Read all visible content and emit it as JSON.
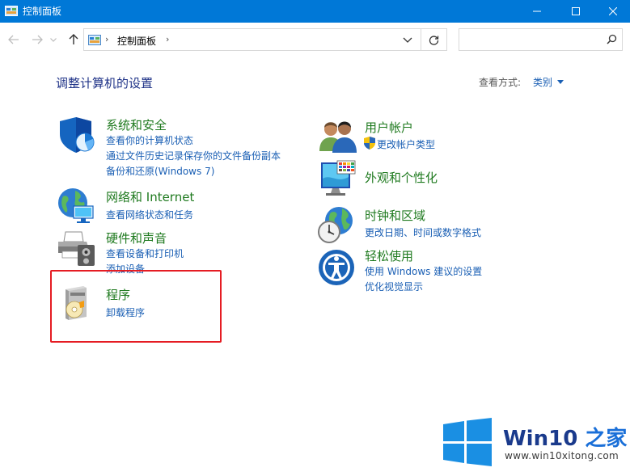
{
  "window": {
    "title": "控制面板",
    "minimize_icon": "minimize-icon",
    "maximize_icon": "maximize-icon",
    "close_icon": "close-icon"
  },
  "address": {
    "breadcrumb": "控制面板",
    "search_placeholder": "",
    "icons": [
      "back-arrow-icon",
      "forward-arrow-icon",
      "chevron-down-icon",
      "up-arrow-icon",
      "control-panel-icon",
      "refresh-icon",
      "search-icon"
    ]
  },
  "main": {
    "title": "调整计算机的设置",
    "view_by_label": "查看方式:",
    "view_by_value": "类别"
  },
  "categories": [
    {
      "title": "系统和安全",
      "links": [
        "查看你的计算机状态",
        "通过文件历史记录保存你的文件备份副本",
        "备份和还原(Windows 7)"
      ],
      "icon": "shield-icon"
    },
    {
      "title": "网络和 Internet",
      "links": [
        "查看网络状态和任务"
      ],
      "icon": "network-globe-icon"
    },
    {
      "title": "硬件和声音",
      "links": [
        "查看设备和打印机",
        "添加设备"
      ],
      "icon": "printer-icon"
    },
    {
      "title": "程序",
      "links": [
        "卸载程序"
      ],
      "icon": "programs-disc-icon"
    },
    {
      "title": "用户帐户",
      "links": [
        "更改帐户类型"
      ],
      "icon": "users-icon"
    },
    {
      "title": "外观和个性化",
      "links": [],
      "icon": "monitor-palette-icon"
    },
    {
      "title": "时钟和区域",
      "links": [
        "更改日期、时间或数字格式"
      ],
      "icon": "clock-globe-icon"
    },
    {
      "title": "轻松使用",
      "links": [
        "使用 Windows 建议的设置",
        "优化视觉显示"
      ],
      "icon": "ease-of-access-icon"
    }
  ],
  "watermark": {
    "brand_main": "Win10",
    "brand_accent": " 之家",
    "url": "www.win10xitong.com"
  },
  "colors": {
    "titlebar": "#0078d7",
    "link": "#1a5fb4",
    "category_title": "#1f7a1f",
    "highlight": "#e51c23"
  }
}
